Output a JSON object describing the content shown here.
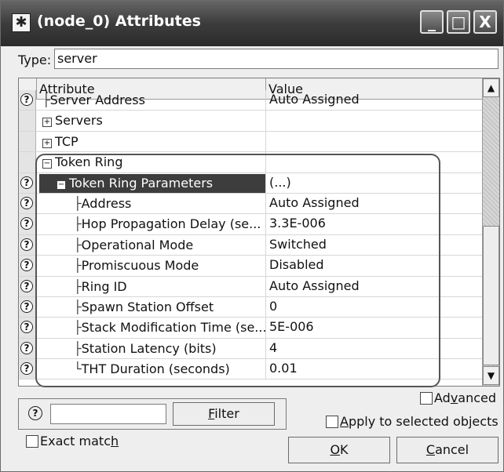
{
  "window": {
    "title": "(node_0) Attributes",
    "app_icon": "asterisk-app-icon",
    "controls": {
      "minimize": "_",
      "maximize": "□",
      "close": "X"
    }
  },
  "type": {
    "label": "Type:",
    "value": "server"
  },
  "table": {
    "headers": {
      "attribute": "Attribute",
      "value": "Value"
    },
    "rows": [
      {
        "has_help": true,
        "indent": 1,
        "prefix": "├",
        "name": "Server Address",
        "value": "Auto Assigned"
      },
      {
        "has_help": false,
        "indent": 1,
        "expander": "+",
        "name": "Servers",
        "value": ""
      },
      {
        "has_help": false,
        "indent": 1,
        "expander": "+",
        "name": "TCP",
        "value": ""
      },
      {
        "has_help": false,
        "indent": 1,
        "expander": "−",
        "name": "Token Ring",
        "value": ""
      },
      {
        "has_help": true,
        "indent": 2,
        "expander": "−",
        "name": "Token Ring Parameters",
        "value": "(...)",
        "selected": true
      },
      {
        "has_help": true,
        "indent": 3,
        "prefix": "├",
        "name": "Address",
        "value": "Auto Assigned"
      },
      {
        "has_help": true,
        "indent": 3,
        "prefix": "├",
        "name": "Hop Propagation Delay (se...",
        "value": "3.3E-006"
      },
      {
        "has_help": true,
        "indent": 3,
        "prefix": "├",
        "name": "Operational Mode",
        "value": "Switched"
      },
      {
        "has_help": true,
        "indent": 3,
        "prefix": "├",
        "name": "Promiscuous Mode",
        "value": "Disabled"
      },
      {
        "has_help": true,
        "indent": 3,
        "prefix": "├",
        "name": "Ring ID",
        "value": "Auto Assigned"
      },
      {
        "has_help": true,
        "indent": 3,
        "prefix": "├",
        "name": "Spawn Station Offset",
        "value": "0"
      },
      {
        "has_help": true,
        "indent": 3,
        "prefix": "├",
        "name": "Stack Modification Time (se...",
        "value": "5E-006"
      },
      {
        "has_help": true,
        "indent": 3,
        "prefix": "├",
        "name": "Station Latency (bits)",
        "value": "4"
      },
      {
        "has_help": true,
        "indent": 3,
        "prefix": "└",
        "name": "THT Duration (seconds)",
        "value": "0.01"
      }
    ],
    "help_glyph": "?",
    "scroll_up": "▲",
    "scroll_down": "▼"
  },
  "filter": {
    "icon": "help-icon",
    "icon_glyph": "?",
    "input_value": "",
    "filter_button": {
      "pre": "",
      "mnemonic": "F",
      "post": "ilter"
    },
    "exact_match": {
      "pre": "Exact matc",
      "mnemonic": "h",
      "post": "",
      "checked": false
    }
  },
  "advanced": {
    "pre": "Ad",
    "mnemonic": "v",
    "post": "anced",
    "checked": false
  },
  "apply_selected": {
    "pre": "",
    "mnemonic": "A",
    "post": "pply to selected objects",
    "checked": false
  },
  "buttons": {
    "ok": {
      "mnemonic": "O",
      "post": "K"
    },
    "cancel": {
      "mnemonic": "C",
      "post": "ancel"
    }
  }
}
